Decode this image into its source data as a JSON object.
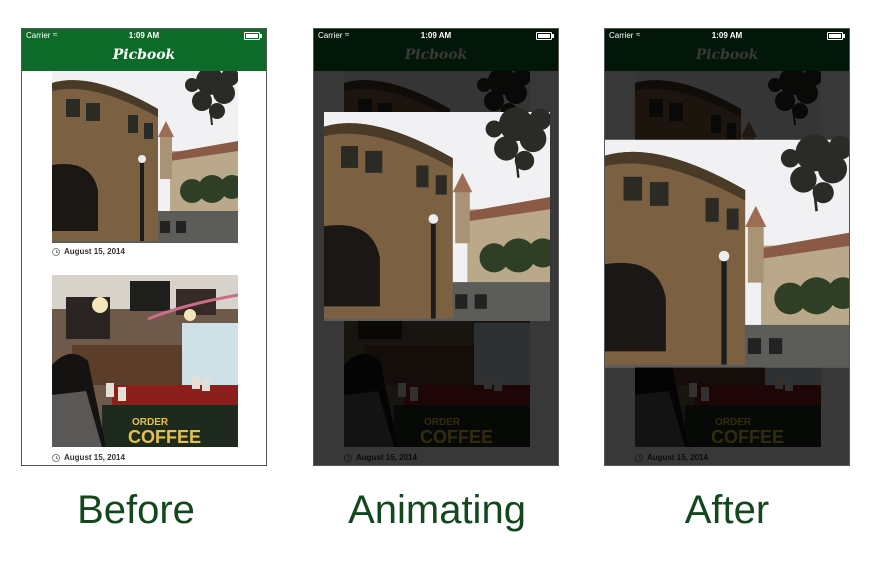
{
  "status_bar": {
    "carrier": "Carrier",
    "time": "1:09 AM"
  },
  "app": {
    "title": "Picbook"
  },
  "posts": [
    {
      "date": "August 15, 2014"
    },
    {
      "date": "August 15, 2014"
    }
  ],
  "captions": {
    "before": "Before",
    "animating": "Animating",
    "after": "After"
  },
  "colors": {
    "navbar": "#0e6a29",
    "caption": "#13481f"
  }
}
